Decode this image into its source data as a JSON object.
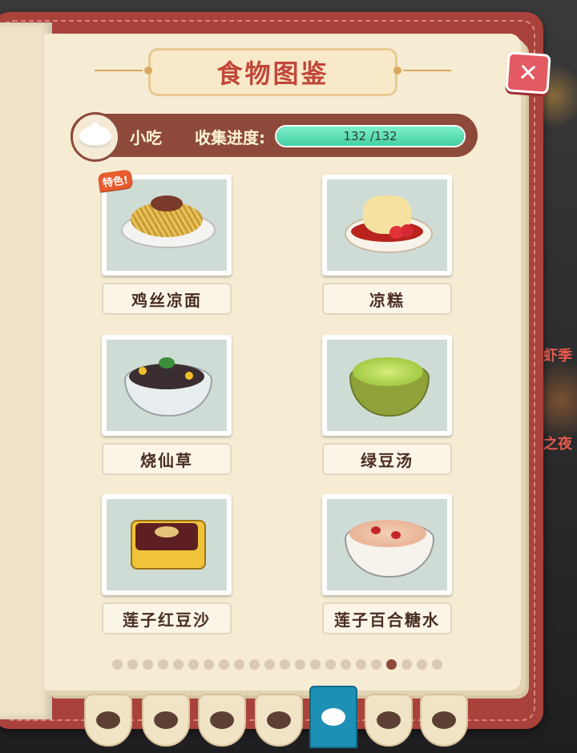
{
  "header": {
    "title": "食物图鉴",
    "close_label": "✕"
  },
  "category": {
    "name": "小吃",
    "progress_label": "收集进度:",
    "progress_text": "132 /132",
    "collected": 132,
    "total": 132,
    "icon": "steamed-bun-icon"
  },
  "foods": [
    {
      "name": "鸡丝凉面",
      "badge": "特色!"
    },
    {
      "name": "凉糕"
    },
    {
      "name": "烧仙草"
    },
    {
      "name": "绿豆汤"
    },
    {
      "name": "莲子红豆沙"
    },
    {
      "name": "莲子百合糖水"
    }
  ],
  "pagination": {
    "pages": 22,
    "current": 19
  },
  "tabs": [
    {
      "icon": "wok-icon"
    },
    {
      "icon": "drumstick-icon"
    },
    {
      "icon": "broccoli-icon"
    },
    {
      "icon": "fish-icon"
    },
    {
      "icon": "bun-icon",
      "active": true
    },
    {
      "icon": "drink-icon"
    },
    {
      "icon": "rice-bowl-icon"
    }
  ],
  "side": {
    "text1": "虾季",
    "text2": "之夜"
  },
  "colors": {
    "accent": "#c0483a",
    "progress": "#45cfa5",
    "active_tab": "#1e8fb5",
    "frame": "#a8423a"
  }
}
